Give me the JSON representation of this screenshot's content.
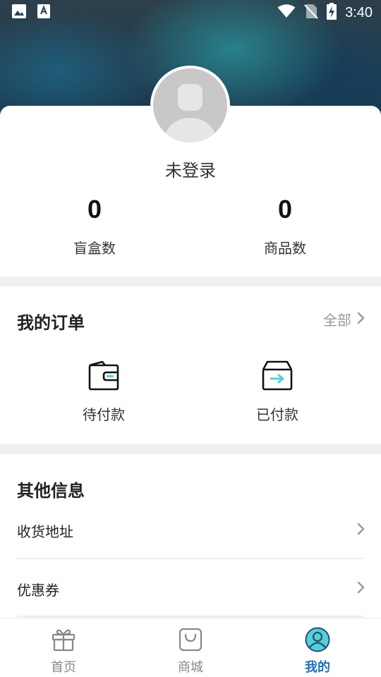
{
  "status_bar": {
    "time": "3:40",
    "icons": [
      "image-icon",
      "text-a-icon",
      "wifi-icon",
      "no-sim-icon",
      "battery-charging-icon"
    ]
  },
  "profile": {
    "nickname": "未登录",
    "stats": [
      {
        "value": "0",
        "label": "盲盒数"
      },
      {
        "value": "0",
        "label": "商品数"
      }
    ]
  },
  "orders": {
    "title": "我的订单",
    "all_label": "全部",
    "items": [
      {
        "label": "待付款",
        "icon": "wallet-icon"
      },
      {
        "label": "已付款",
        "icon": "box-arrow-icon"
      }
    ]
  },
  "other": {
    "title": "其他信息",
    "rows": [
      {
        "label": "收货地址"
      },
      {
        "label": "优惠券"
      }
    ]
  },
  "tabbar": {
    "active": "我的",
    "tabs": [
      {
        "label": "首页",
        "icon": "gift-icon"
      },
      {
        "label": "商城",
        "icon": "shopping-bag-icon"
      },
      {
        "label": "我的",
        "icon": "user-circle-icon"
      }
    ]
  },
  "colors": {
    "accent": "#1f6fb2",
    "icon_teal": "#55cfd6",
    "muted": "#999999"
  }
}
